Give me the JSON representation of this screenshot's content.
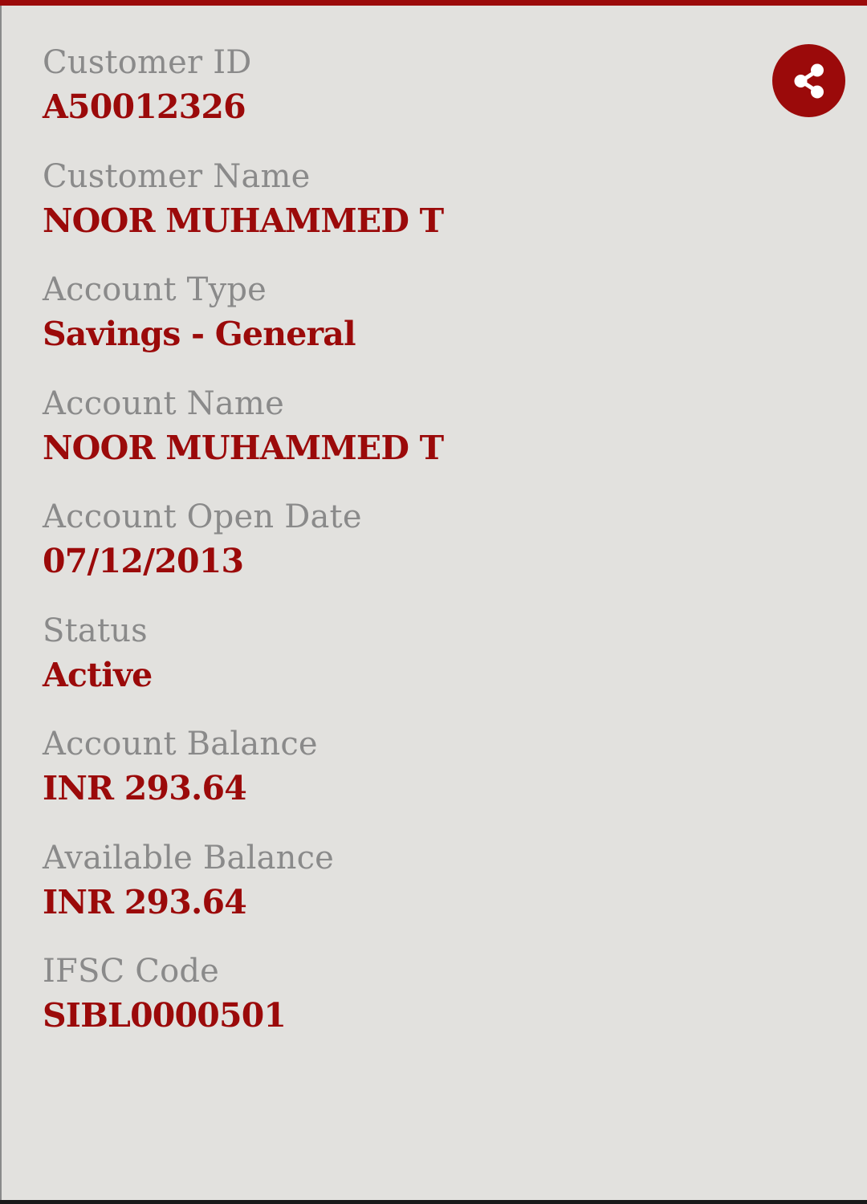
{
  "colors": {
    "accent": "#9b0a0a",
    "label": "#8a8a8a",
    "background": "#e2e1de"
  },
  "share_button": {
    "icon": "share-icon"
  },
  "fields": [
    {
      "label": "Customer ID",
      "value": "A50012326"
    },
    {
      "label": "Customer Name",
      "value": "NOOR MUHAMMED T"
    },
    {
      "label": "Account Type",
      "value": "Savings - General"
    },
    {
      "label": "Account Name",
      "value": "NOOR MUHAMMED T"
    },
    {
      "label": "Account Open Date",
      "value": "07/12/2013"
    },
    {
      "label": "Status",
      "value": "Active"
    },
    {
      "label": "Account Balance",
      "value": "INR 293.64"
    },
    {
      "label": "Available Balance",
      "value": "INR 293.64"
    },
    {
      "label": "IFSC Code",
      "value": "SIBL0000501"
    }
  ]
}
